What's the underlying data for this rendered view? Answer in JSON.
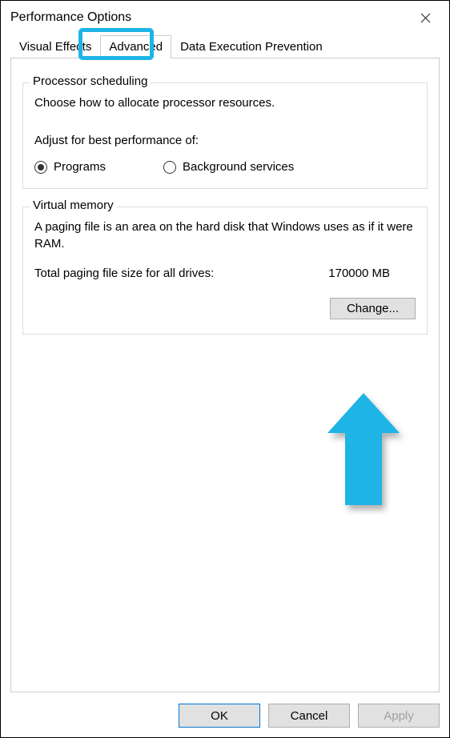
{
  "window": {
    "title": "Performance Options"
  },
  "tabs": {
    "visual_effects": "Visual Effects",
    "advanced": "Advanced",
    "dep": "Data Execution Prevention"
  },
  "processor": {
    "title": "Processor scheduling",
    "description": "Choose how to allocate processor resources.",
    "label": "Adjust for best performance of:",
    "option_programs": "Programs",
    "option_background": "Background services",
    "selected": "programs"
  },
  "virtual_memory": {
    "title": "Virtual memory",
    "description": "A paging file is an area on the hard disk that Windows uses as if it were RAM.",
    "total_label": "Total paging file size for all drives:",
    "total_value": "170000 MB",
    "change_button": "Change..."
  },
  "buttons": {
    "ok": "OK",
    "cancel": "Cancel",
    "apply": "Apply"
  },
  "annotation": {
    "highlight_color": "#1eb4e6",
    "arrow_color": "#1eb4e6"
  }
}
